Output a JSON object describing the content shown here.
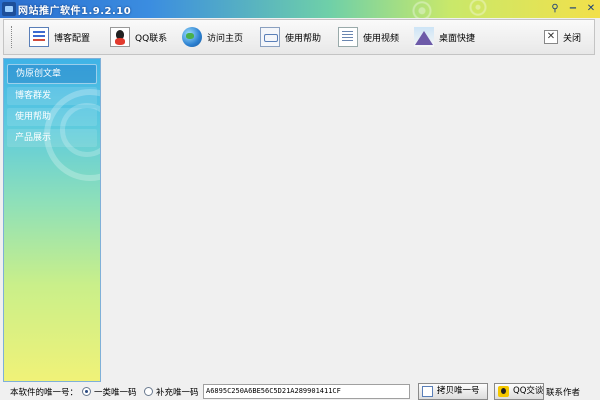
{
  "window": {
    "title": "网站推广软件1.9.2.10"
  },
  "toolbar": {
    "items": [
      {
        "label": "博客配置",
        "icon": "config-icon"
      },
      {
        "label": "QQ联系",
        "icon": "qq-icon"
      },
      {
        "label": "访问主页",
        "icon": "globe-icon"
      },
      {
        "label": "使用帮助",
        "icon": "help-icon"
      },
      {
        "label": "使用视频",
        "icon": "video-icon"
      },
      {
        "label": "桌面快捷",
        "icon": "mountain-icon"
      }
    ],
    "close_label": "关闭"
  },
  "sidebar": {
    "items": [
      {
        "label": "伪原创文章"
      },
      {
        "label": "博客群发"
      },
      {
        "label": "使用帮助"
      },
      {
        "label": "产品展示"
      }
    ]
  },
  "status": {
    "machine_code_label": "本软件的唯一号：",
    "radio_primary": "一类唯一码",
    "radio_secondary": "补充唯一码",
    "selected_radio": "一类唯一码",
    "machine_code": "A6895C250A6BE56C5D21A289901411CF",
    "copy_button": "拷贝唯一号",
    "qq_button": "QQ交谈",
    "contact_label": "联系作者"
  }
}
